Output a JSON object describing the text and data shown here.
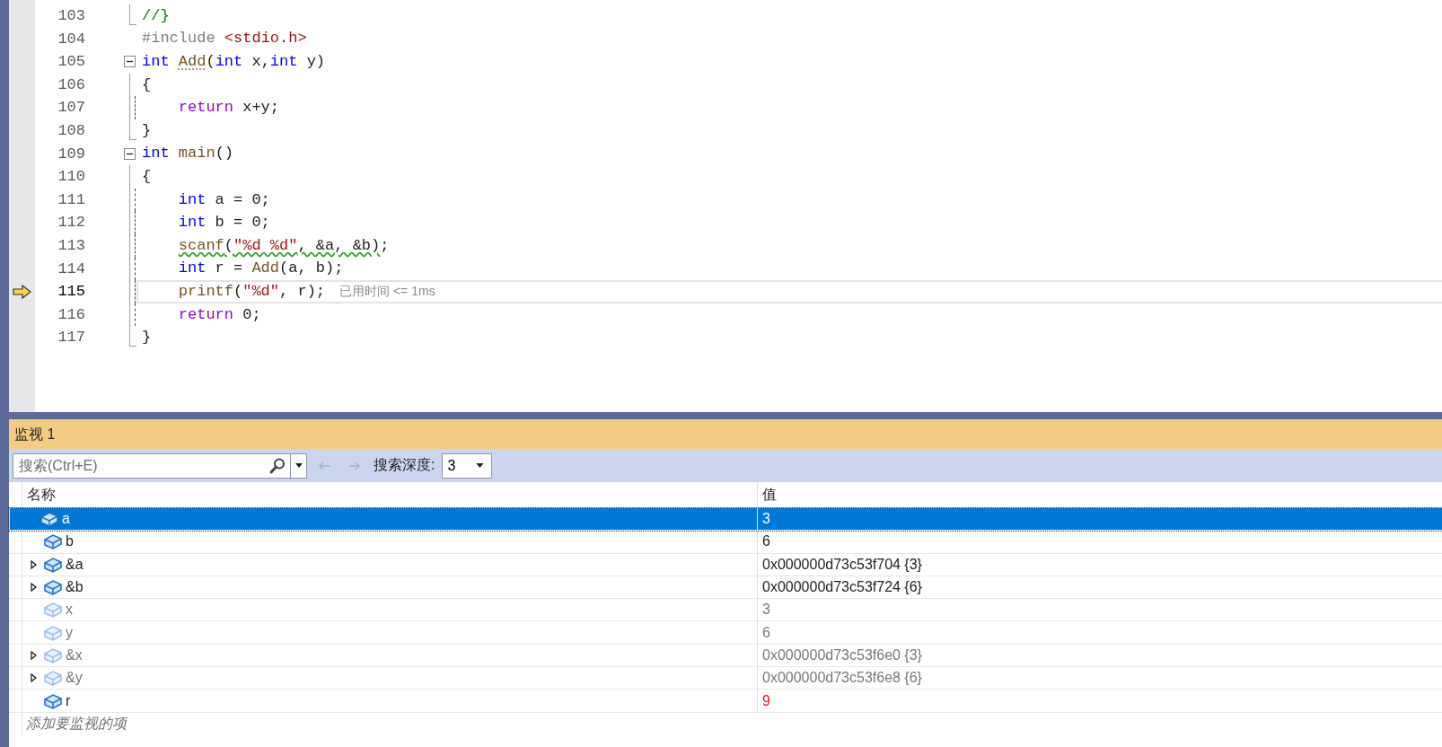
{
  "editor": {
    "lines": [
      {
        "number": "103",
        "kind": "end",
        "indented": false,
        "current": false,
        "tokens": [
          {
            "kind": "comment",
            "t": "//}"
          }
        ]
      },
      {
        "number": "104",
        "kind": "none",
        "indented": false,
        "current": false,
        "tokens": [
          {
            "kind": "pp",
            "t": "#include "
          },
          {
            "kind": "str",
            "t": "<stdio.h>"
          }
        ]
      },
      {
        "number": "105",
        "kind": "start",
        "indented": false,
        "current": false,
        "tokens": [
          {
            "kind": "kw",
            "t": "int "
          },
          {
            "kind": "dotted",
            "tokens": [
              {
                "kind": "fn",
                "t": "Add"
              }
            ]
          },
          {
            "kind": "plain",
            "t": "("
          },
          {
            "kind": "kw",
            "t": "int "
          },
          {
            "kind": "plain",
            "t": "x,"
          },
          {
            "kind": "kw",
            "t": "int "
          },
          {
            "kind": "plain",
            "t": "y)"
          }
        ]
      },
      {
        "number": "106",
        "kind": "line",
        "indented": false,
        "current": false,
        "tokens": [
          {
            "kind": "plain",
            "t": "{"
          }
        ]
      },
      {
        "number": "107",
        "kind": "dashed",
        "indented": true,
        "current": false,
        "tokens": [
          {
            "kind": "ctrl",
            "t": "return "
          },
          {
            "kind": "plain",
            "t": "x+y;"
          }
        ]
      },
      {
        "number": "108",
        "kind": "end",
        "indented": false,
        "current": false,
        "tokens": [
          {
            "kind": "plain",
            "t": "}"
          }
        ]
      },
      {
        "number": "109",
        "kind": "start",
        "indented": false,
        "current": false,
        "tokens": [
          {
            "kind": "kw",
            "t": "int "
          },
          {
            "kind": "fn",
            "t": "main"
          },
          {
            "kind": "plain",
            "t": "()"
          }
        ]
      },
      {
        "number": "110",
        "kind": "line",
        "indented": false,
        "current": false,
        "tokens": [
          {
            "kind": "plain",
            "t": "{"
          }
        ]
      },
      {
        "number": "111",
        "kind": "dashed",
        "indented": true,
        "current": false,
        "tokens": [
          {
            "kind": "kw",
            "t": "int "
          },
          {
            "kind": "plain",
            "t": "a = 0;"
          }
        ]
      },
      {
        "number": "112",
        "kind": "dashed",
        "indented": true,
        "current": false,
        "tokens": [
          {
            "kind": "kw",
            "t": "int "
          },
          {
            "kind": "plain",
            "t": "b = 0;"
          }
        ]
      },
      {
        "number": "113",
        "kind": "dashed",
        "indented": true,
        "current": false,
        "tokens": [
          {
            "kind": "wavy",
            "tokens": [
              {
                "kind": "fn",
                "t": "scanf"
              },
              {
                "kind": "plain",
                "t": "("
              },
              {
                "kind": "str",
                "t": "\"%d %d\""
              },
              {
                "kind": "plain",
                "t": ", &a, &b)"
              }
            ]
          },
          {
            "kind": "plain",
            "t": ";"
          }
        ]
      },
      {
        "number": "114",
        "kind": "dashed",
        "indented": true,
        "current": false,
        "tokens": [
          {
            "kind": "kw",
            "t": "int "
          },
          {
            "kind": "plain",
            "t": "r = "
          },
          {
            "kind": "fn",
            "t": "Add"
          },
          {
            "kind": "plain",
            "t": "(a, b);"
          }
        ]
      },
      {
        "number": "115",
        "kind": "dashed",
        "indented": true,
        "current": true,
        "hint": "已用时间 <= 1ms",
        "tokens": [
          {
            "kind": "fn",
            "t": "printf"
          },
          {
            "kind": "plain",
            "t": "("
          },
          {
            "kind": "str",
            "t": "\"%d\""
          },
          {
            "kind": "plain",
            "t": ", r);"
          }
        ]
      },
      {
        "number": "116",
        "kind": "dashed",
        "indented": true,
        "current": false,
        "tokens": [
          {
            "kind": "ctrl",
            "t": "return "
          },
          {
            "kind": "plain",
            "t": "0;"
          }
        ]
      },
      {
        "number": "117",
        "kind": "end",
        "indented": false,
        "current": false,
        "tokens": [
          {
            "kind": "plain",
            "t": "}"
          }
        ]
      }
    ]
  },
  "watch": {
    "title": "监视 1",
    "search": {
      "placeholder": "搜索(Ctrl+E)"
    },
    "nav_buttons": [
      {
        "kind": "back",
        "disabled": true
      },
      {
        "kind": "forward",
        "disabled": true
      }
    ],
    "depth": {
      "label": "搜索深度:",
      "value": "3"
    },
    "columns": [
      "名称",
      "值"
    ],
    "rows": [
      {
        "name": "a",
        "value": "3",
        "expandable": false,
        "selected": true,
        "stale": false,
        "changed": false
      },
      {
        "name": "b",
        "value": "6",
        "expandable": false,
        "selected": false,
        "stale": false,
        "changed": false
      },
      {
        "name": "&a",
        "value": "0x000000d73c53f704 {3}",
        "expandable": true,
        "selected": false,
        "stale": false,
        "changed": false
      },
      {
        "name": "&b",
        "value": "0x000000d73c53f724 {6}",
        "expandable": true,
        "selected": false,
        "stale": false,
        "changed": false
      },
      {
        "name": "x",
        "value": "3",
        "expandable": false,
        "selected": false,
        "stale": true,
        "changed": false
      },
      {
        "name": "y",
        "value": "6",
        "expandable": false,
        "selected": false,
        "stale": true,
        "changed": false
      },
      {
        "name": "&x",
        "value": "0x000000d73c53f6e0 {3}",
        "expandable": true,
        "selected": false,
        "stale": true,
        "changed": false
      },
      {
        "name": "&y",
        "value": "0x000000d73c53f6e8 {6}",
        "expandable": true,
        "selected": false,
        "stale": true,
        "changed": false
      },
      {
        "name": "r",
        "value": "9",
        "expandable": false,
        "selected": false,
        "stale": false,
        "changed": true
      }
    ],
    "add_placeholder": "添加要监视的项"
  }
}
